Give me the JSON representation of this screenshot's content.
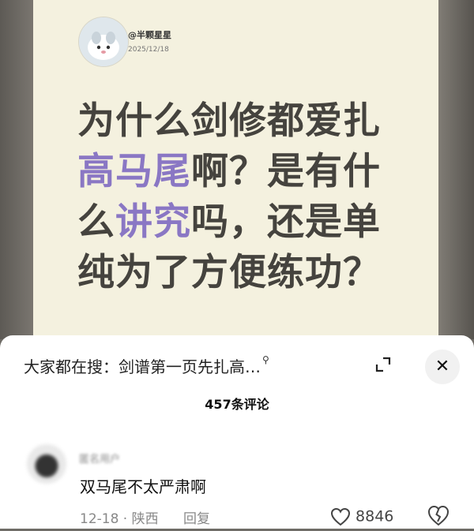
{
  "post": {
    "username": "@半颗星星",
    "date": "2025/12/18",
    "headline_lines": [
      [
        {
          "text": "为什么剑修都爱扎",
          "hl": false
        }
      ],
      [
        {
          "text": "高马尾",
          "hl": true
        },
        {
          "text": "啊？是有什",
          "hl": false
        }
      ],
      [
        {
          "text": "么",
          "hl": false
        },
        {
          "text": "讲究",
          "hl": true
        },
        {
          "text": "吗，还是单",
          "hl": false
        }
      ],
      [
        {
          "text": "纯为了方便练功？",
          "hl": false
        }
      ]
    ]
  },
  "panel": {
    "search_hint": "大家都在搜：剑谱第一页先扎高…",
    "comment_count": "457条评论"
  },
  "comment": {
    "text": "双马尾不太严肃啊",
    "date_location": "12-18 · 陕西",
    "reply_label": "回复",
    "likes": "8846"
  },
  "colors": {
    "highlight": "#8a77c4",
    "headline": "#45433e",
    "card_bg": "#f4f1df"
  },
  "icons": [
    "search-icon",
    "expand-icon",
    "close-icon",
    "heart-icon",
    "broken-heart-icon"
  ]
}
